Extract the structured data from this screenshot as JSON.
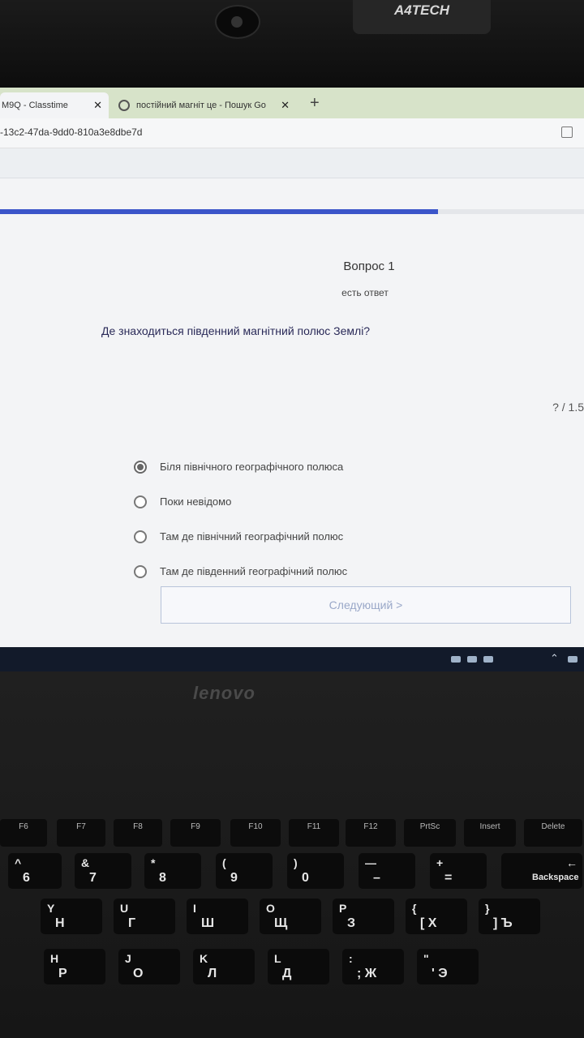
{
  "webcam": {
    "brand": "A4TECH"
  },
  "browser": {
    "tabs": [
      {
        "label": "M9Q - Classtime"
      },
      {
        "label": "постійний магніт це - Пошук Go"
      }
    ],
    "url": "-13c2-47da-9dd0-810a3e8dbe7d"
  },
  "quiz": {
    "progress": 0.75,
    "question_number": "Вопрос 1",
    "status": "есть ответ",
    "question": "Де знаходиться південний магнітний полюс Землі?",
    "score": "? / 1.5",
    "options": [
      {
        "label": "Біля північного географічного полюса",
        "selected": true
      },
      {
        "label": "Поки невідомо",
        "selected": false
      },
      {
        "label": "Там де північний географічний полюс",
        "selected": false
      },
      {
        "label": "Там де південний географічний полюс",
        "selected": false
      }
    ],
    "next_label": "Следующий >"
  },
  "laptop": {
    "brand": "lenovo",
    "fkeys": [
      "F6",
      "F7",
      "F8",
      "F9",
      "F10",
      "F11",
      "F12",
      "PrtSc",
      "Insert",
      "Delete"
    ],
    "number_row": [
      {
        "top": "^",
        "bottom": "6"
      },
      {
        "top": "&",
        "bottom": "7"
      },
      {
        "top": "*",
        "bottom": "8"
      },
      {
        "top": "(",
        "bottom": "9"
      },
      {
        "top": ")",
        "bottom": "0"
      },
      {
        "top": "—",
        "bottom": "–"
      },
      {
        "top": "+",
        "bottom": "="
      },
      {
        "top": "←",
        "bottom": "Backspace"
      }
    ],
    "letter_row_1": [
      {
        "top": "Y",
        "bottom": "Н"
      },
      {
        "top": "U",
        "bottom": "Г"
      },
      {
        "top": "I",
        "bottom": "Ш"
      },
      {
        "top": "O",
        "bottom": "Щ"
      },
      {
        "top": "P",
        "bottom": "З"
      },
      {
        "top": "{",
        "bottom": "[ Х"
      },
      {
        "top": "}",
        "bottom": "] Ъ"
      }
    ],
    "letter_row_2": [
      {
        "top": "H",
        "bottom": "Р"
      },
      {
        "top": "J",
        "bottom": "О"
      },
      {
        "top": "K",
        "bottom": "Л"
      },
      {
        "top": "L",
        "bottom": "Д"
      },
      {
        "top": ":",
        "bottom": "; Ж"
      },
      {
        "top": "\"",
        "bottom": "' Э"
      }
    ]
  }
}
